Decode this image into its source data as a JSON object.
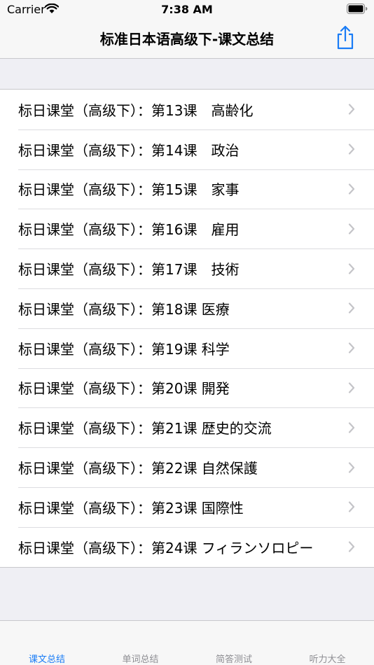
{
  "status_bar": {
    "carrier": "Carrier",
    "time": "7:38 AM"
  },
  "nav": {
    "title": "标准日本语高级下-课文总结",
    "share_icon": "share-icon"
  },
  "lessons": [
    "标日课堂（高级下）：第13课　高齢化",
    "标日课堂（高级下）：第14课　政治",
    "标日课堂（高级下）：第15课　家事",
    "标日课堂（高级下）：第16课　雇用",
    "标日课堂（高级下）：第17课　技術",
    "标日课堂（高级下）：第18课 医療",
    "标日课堂（高级下）：第19课 科学",
    "标日课堂（高级下）：第20课 開発",
    "标日课堂（高级下）：第21课 歴史的交流",
    "标日课堂（高级下）：第22课 自然保護",
    "标日课堂（高级下）：第23课 国際性",
    "标日课堂（高级下）：第24课 フィランソロピー"
  ],
  "tabs": [
    {
      "label": "课文总结",
      "active": true
    },
    {
      "label": "单词总结",
      "active": false
    },
    {
      "label": "简答测试",
      "active": false
    },
    {
      "label": "听力大全",
      "active": false
    }
  ],
  "colors": {
    "accent": "#1a7cf6",
    "inactive": "#8e8e93",
    "background": "#efeff4"
  }
}
